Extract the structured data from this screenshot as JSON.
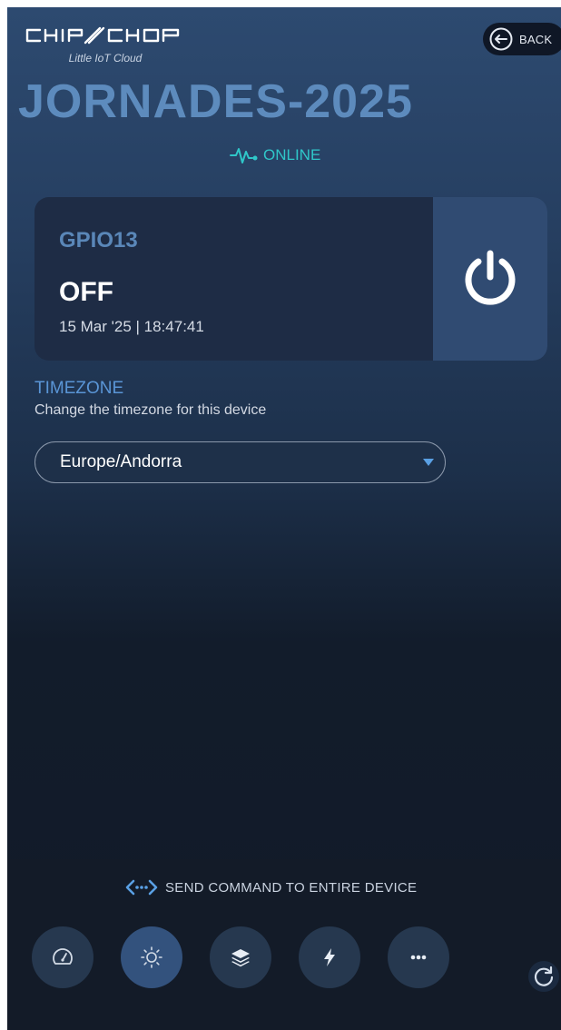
{
  "brand": {
    "wordmark": "CHIP/CHOP",
    "tagline": "Little IoT Cloud"
  },
  "header": {
    "back_label": "BACK"
  },
  "device": {
    "name": "JORNADES-2025",
    "status": "ONLINE"
  },
  "gpio_card": {
    "pin": "GPIO13",
    "state": "OFF",
    "timestamp": "15 Mar '25 | 18:47:41",
    "power_icon": "power-icon"
  },
  "timezone": {
    "label": "TIMEZONE",
    "help": "Change the timezone for this device",
    "selected": "Europe/Andorra"
  },
  "bottom": {
    "send_command_label": "SEND COMMAND TO ENTIRE DEVICE",
    "nav": [
      {
        "icon": "dashboard-gauge-icon",
        "active": false
      },
      {
        "icon": "sun-icon",
        "active": true
      },
      {
        "icon": "layers-icon",
        "active": false
      },
      {
        "icon": "lightning-icon",
        "active": false
      },
      {
        "icon": "more-icon",
        "active": false
      }
    ],
    "refresh_icon": "refresh-icon"
  },
  "colors": {
    "accent": "#5d8bbd",
    "online": "#2fc7c9",
    "card_bg": "#1e2c45",
    "power_bg": "#304b72"
  }
}
